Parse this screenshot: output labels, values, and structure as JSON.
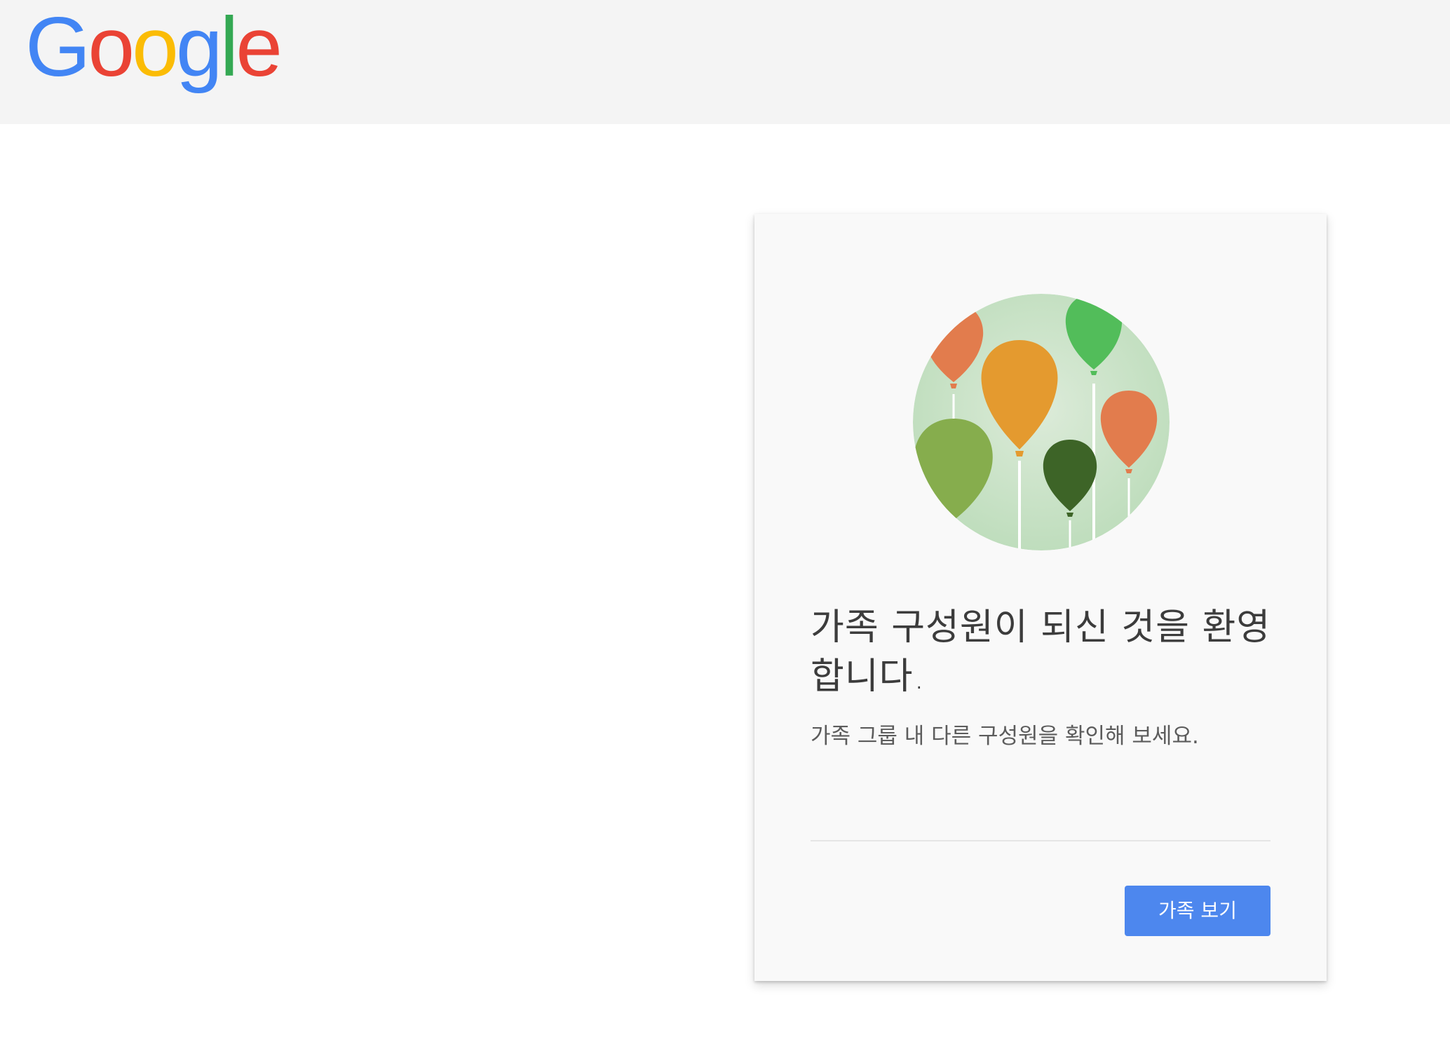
{
  "header": {
    "logo_text": "Google",
    "logo_colors": [
      "#4285F4",
      "#EA4335",
      "#FBBC05",
      "#4285F4",
      "#34A853",
      "#EA4335"
    ]
  },
  "card": {
    "illustration_icon": "balloons-illustration",
    "title": "가족 구성원이 되신 것을 환영합니다.",
    "subtitle": "가족 그룹 내 다른 구성원을 확인해 보세요.",
    "button_label": "가족 보기",
    "button_color": "#4d87ee"
  }
}
